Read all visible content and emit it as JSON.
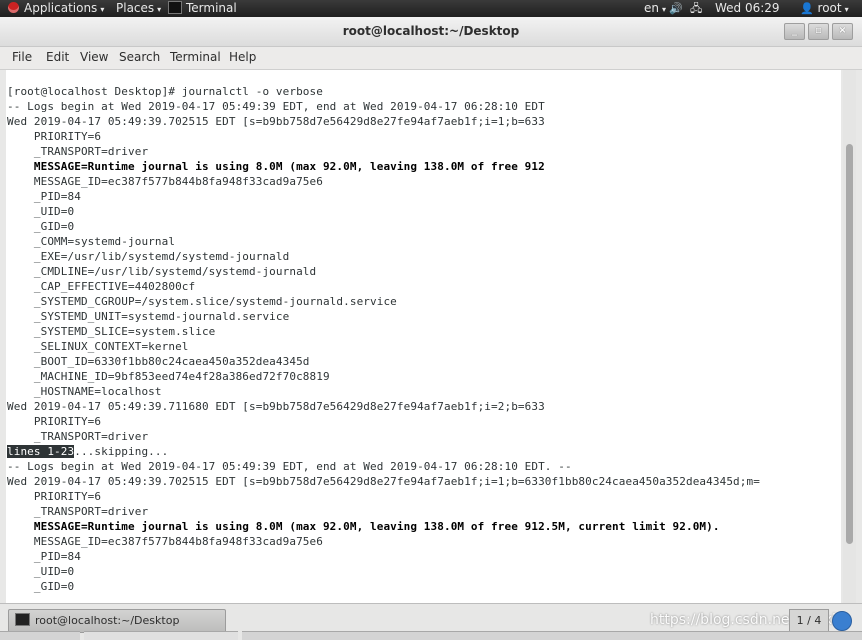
{
  "top_panel": {
    "applications": "Applications",
    "places": "Places",
    "task": "Terminal",
    "language": "en",
    "clock": "Wed 06:29",
    "user": "root",
    "icons": [
      "redhat-logo-icon",
      "volume-icon",
      "network-icon",
      "user-icon"
    ]
  },
  "window": {
    "title": "root@localhost:~/Desktop",
    "controls": {
      "minimize": "_",
      "maximize": "▫",
      "close": "×"
    }
  },
  "menu": [
    "File",
    "Edit",
    "View",
    "Search",
    "Terminal",
    "Help"
  ],
  "terminal": {
    "lines": [
      {
        "text": "[root@localhost Desktop]# journalctl -o verbose"
      },
      {
        "text": "-- Logs begin at Wed 2019-04-17 05:49:39 EDT, end at Wed 2019-04-17 06:28:10 EDT"
      },
      {
        "text": "Wed 2019-04-17 05:49:39.702515 EDT [s=b9bb758d7e56429d8e27fe94af7aeb1f;i=1;b=633"
      },
      {
        "text": "    PRIORITY=6"
      },
      {
        "text": "    _TRANSPORT=driver"
      },
      {
        "text": "    MESSAGE=Runtime journal is using 8.0M (max 92.0M, leaving 138.0M of free 912",
        "bold": true
      },
      {
        "text": "    MESSAGE_ID=ec387f577b844b8fa948f33cad9a75e6"
      },
      {
        "text": "    _PID=84"
      },
      {
        "text": "    _UID=0"
      },
      {
        "text": "    _GID=0"
      },
      {
        "text": "    _COMM=systemd-journal"
      },
      {
        "text": "    _EXE=/usr/lib/systemd/systemd-journald"
      },
      {
        "text": "    _CMDLINE=/usr/lib/systemd/systemd-journald"
      },
      {
        "text": "    _CAP_EFFECTIVE=4402800cf"
      },
      {
        "text": "    _SYSTEMD_CGROUP=/system.slice/systemd-journald.service"
      },
      {
        "text": "    _SYSTEMD_UNIT=systemd-journald.service"
      },
      {
        "text": "    _SYSTEMD_SLICE=system.slice"
      },
      {
        "text": "    _SELINUX_CONTEXT=kernel"
      },
      {
        "text": "    _BOOT_ID=6330f1bb80c24caea450a352dea4345d"
      },
      {
        "text": "    _MACHINE_ID=9bf853eed74e4f28a386ed72f70c8819"
      },
      {
        "text": "    _HOSTNAME=localhost"
      },
      {
        "text": "Wed 2019-04-17 05:49:39.711680 EDT [s=b9bb758d7e56429d8e27fe94af7aeb1f;i=2;b=633"
      },
      {
        "text": "    PRIORITY=6"
      },
      {
        "text": "    _TRANSPORT=driver"
      },
      {
        "text": "...skipping...",
        "prompt": "lines 1-23"
      },
      {
        "text": "-- Logs begin at Wed 2019-04-17 05:49:39 EDT, end at Wed 2019-04-17 06:28:10 EDT. --"
      },
      {
        "text": "Wed 2019-04-17 05:49:39.702515 EDT [s=b9bb758d7e56429d8e27fe94af7aeb1f;i=1;b=6330f1bb80c24caea450a352dea4345d;m="
      },
      {
        "text": "    PRIORITY=6"
      },
      {
        "text": "    _TRANSPORT=driver"
      },
      {
        "text": "    MESSAGE=Runtime journal is using 8.0M (max 92.0M, leaving 138.0M of free 912.5M, current limit 92.0M).",
        "bold": true
      },
      {
        "text": "    MESSAGE_ID=ec387f577b844b8fa948f33cad9a75e6"
      },
      {
        "text": "    _PID=84"
      },
      {
        "text": "    _UID=0"
      },
      {
        "text": "    _GID=0"
      }
    ]
  },
  "taskbar": {
    "task_label": "root@localhost:~/Desktop",
    "watermark": "https://blog.csdn.net/weixin",
    "workspace": "1 / 4"
  }
}
